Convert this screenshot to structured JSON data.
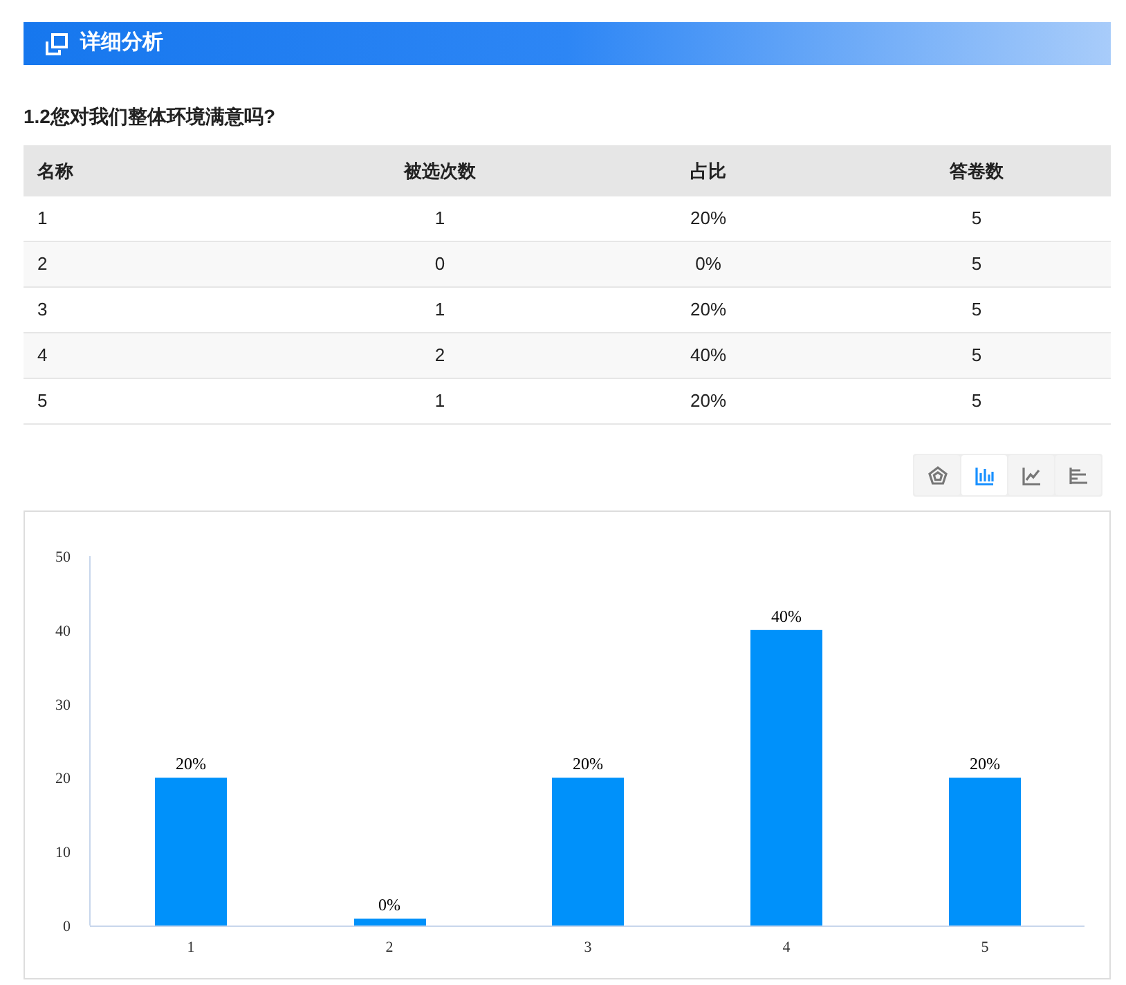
{
  "header": {
    "title": "详细分析"
  },
  "question": {
    "title": "1.2您对我们整体环境满意吗?"
  },
  "table": {
    "columns": [
      "名称",
      "被选次数",
      "占比",
      "答卷数"
    ],
    "rows": [
      [
        "1",
        "1",
        "20%",
        "5"
      ],
      [
        "2",
        "0",
        "0%",
        "5"
      ],
      [
        "3",
        "1",
        "20%",
        "5"
      ],
      [
        "4",
        "2",
        "40%",
        "5"
      ],
      [
        "5",
        "1",
        "20%",
        "5"
      ]
    ]
  },
  "chart_types": [
    {
      "kind": "radar",
      "selected": false
    },
    {
      "kind": "bar",
      "selected": true
    },
    {
      "kind": "line",
      "selected": false
    },
    {
      "kind": "hbar",
      "selected": false
    }
  ],
  "chart_data": {
    "type": "bar",
    "categories": [
      "1",
      "2",
      "3",
      "4",
      "5"
    ],
    "series": [
      {
        "color": "#0091fa",
        "values": [
          20,
          0,
          20,
          40,
          20
        ]
      }
    ],
    "ylim": [
      0,
      50
    ],
    "yticks": [
      0,
      10,
      20,
      30,
      40,
      50
    ],
    "value_labels": [
      "20%",
      "0%",
      "20%",
      "40%",
      "20%"
    ]
  }
}
